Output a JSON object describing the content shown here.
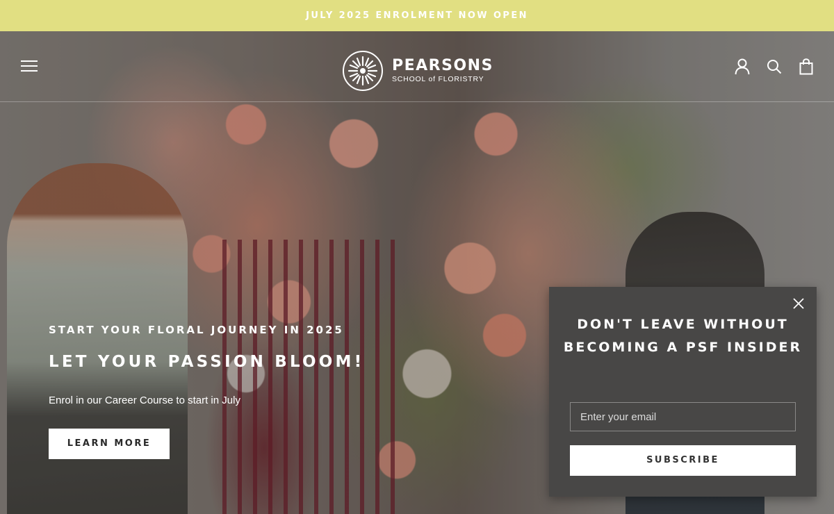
{
  "announcement": {
    "text": "JULY 2025 ENROLMENT NOW OPEN"
  },
  "header": {
    "logo_name": "PEARSONS",
    "logo_sub": "SCHOOL of FLORISTRY",
    "icons": [
      "menu-icon",
      "account-icon",
      "search-icon",
      "cart-icon"
    ]
  },
  "hero": {
    "eyebrow": "START YOUR FLORAL JOURNEY IN 2025",
    "headline": "LET YOUR PASSION BLOOM!",
    "subline": "Enrol in our Career Course to start in July",
    "cta_label": "LEARN MORE"
  },
  "popup": {
    "title": "DON'T LEAVE WITHOUT BECOMING A PSF INSIDER",
    "email_placeholder": "Enter your email",
    "subscribe_label": "SUBSCRIBE"
  },
  "colors": {
    "announcement_bg": "#e1df82",
    "popup_bg": "#484746",
    "button_bg": "#ffffff",
    "text_light": "#ffffff"
  }
}
